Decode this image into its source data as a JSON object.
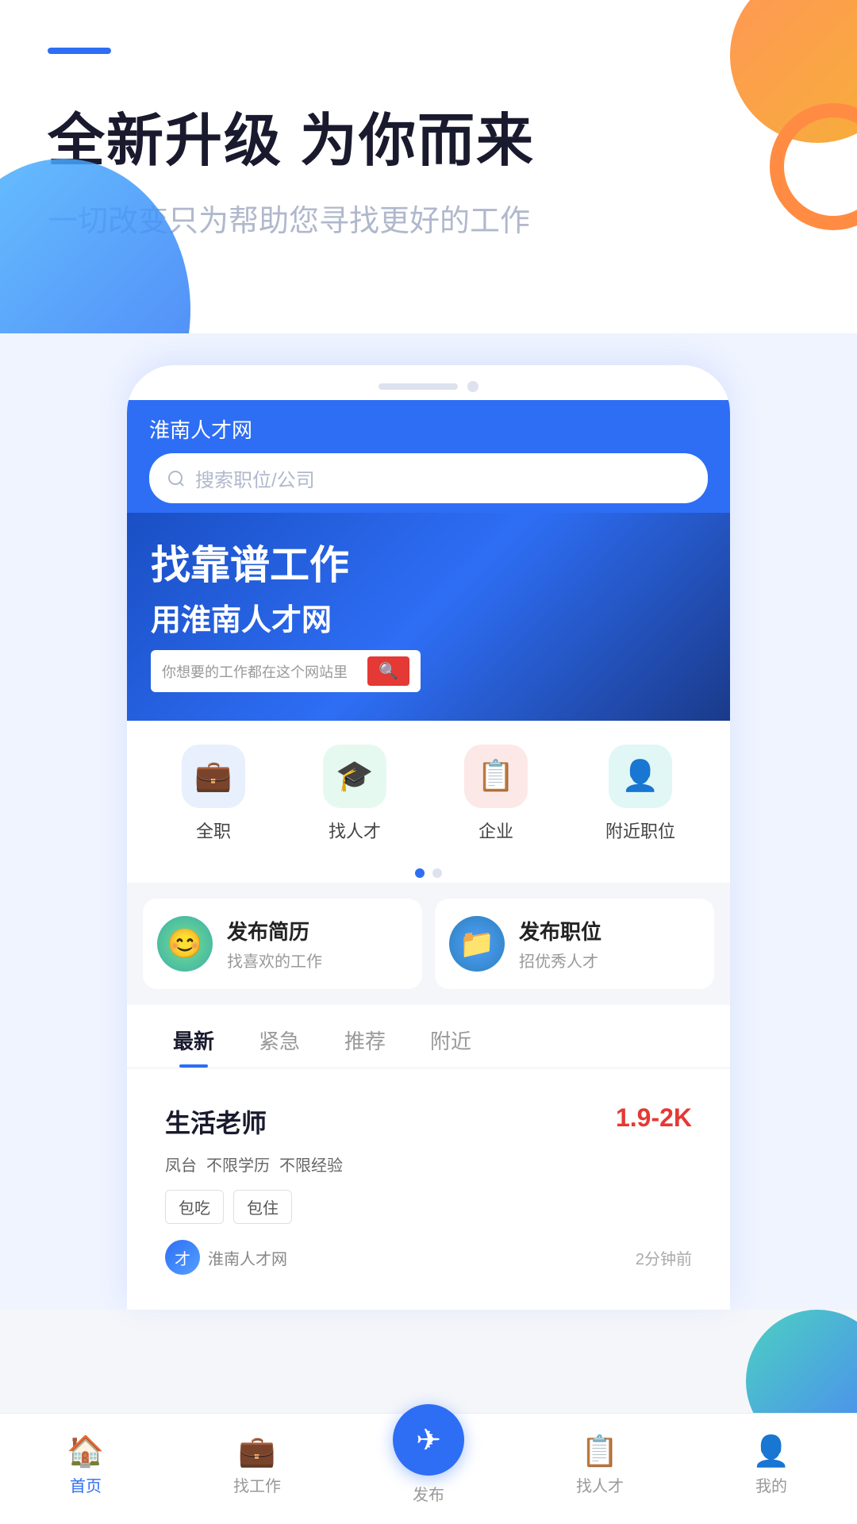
{
  "header": {
    "bar_color": "#2e6ef5",
    "headline": "全新升级 为你而来",
    "subheadline": "一切改变只为帮助您寻找更好的工作"
  },
  "app": {
    "title": "淮南人才网",
    "search_placeholder": "搜索职位/公司"
  },
  "banner": {
    "line1": "找靠谱工作",
    "line2": "用淮南人才网",
    "label": "你想要的工作都在这个网站里"
  },
  "categories": [
    {
      "label": "全职",
      "icon": "💼",
      "color_class": "cat-icon-blue"
    },
    {
      "label": "找人才",
      "icon": "🎓",
      "color_class": "cat-icon-green"
    },
    {
      "label": "企业",
      "icon": "📋",
      "color_class": "cat-icon-red"
    },
    {
      "label": "附近职位",
      "icon": "👤",
      "color_class": "cat-icon-teal"
    }
  ],
  "quick_actions": [
    {
      "title": "发布简历",
      "desc": "找喜欢的工作",
      "icon": "😊",
      "color_class": "quick-icon-green"
    },
    {
      "title": "发布职位",
      "desc": "招优秀人才",
      "icon": "📁",
      "color_class": "quick-icon-blue"
    }
  ],
  "tabs": [
    {
      "label": "最新",
      "active": true
    },
    {
      "label": "紧急",
      "active": false
    },
    {
      "label": "推荐",
      "active": false
    },
    {
      "label": "附近",
      "active": false
    }
  ],
  "job": {
    "title": "生活老师",
    "salary": "1.9-2K",
    "tags": [
      "凤台",
      "不限学历",
      "不限经验"
    ],
    "benefits": [
      "包吃",
      "包住"
    ],
    "company": "淮南人才网",
    "post_time": "2分钟前"
  },
  "bottom_nav": [
    {
      "label": "首页",
      "icon": "🏠",
      "active": true
    },
    {
      "label": "找工作",
      "icon": "💼",
      "active": false
    },
    {
      "label": "发布",
      "icon": "✈",
      "active": false,
      "is_publish": true
    },
    {
      "label": "找人才",
      "icon": "📋",
      "active": false
    },
    {
      "label": "我的",
      "icon": "👤",
      "active": false
    }
  ]
}
